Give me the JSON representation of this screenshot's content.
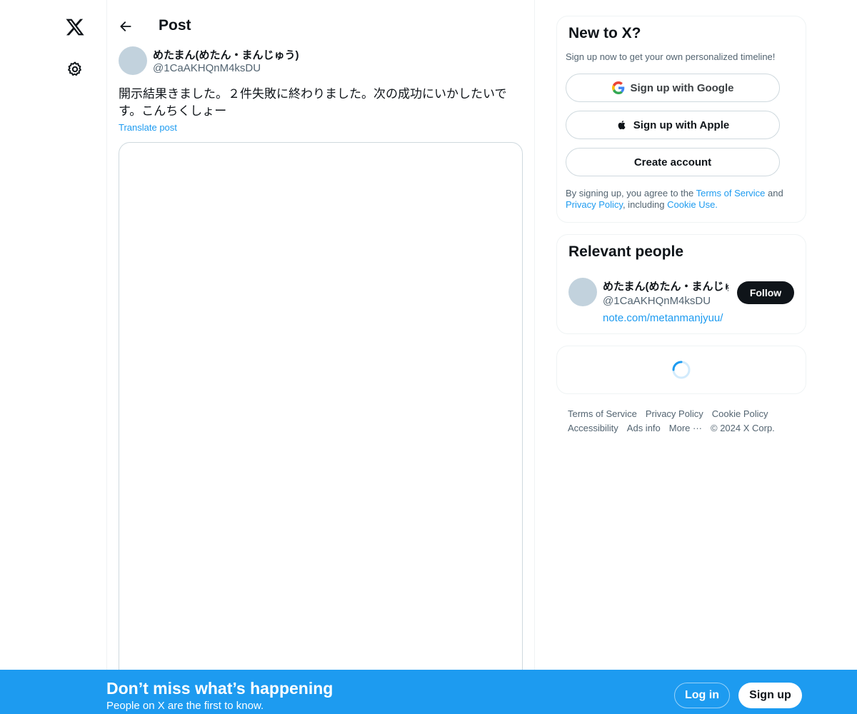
{
  "nav": {
    "logo_icon": "x-logo-icon",
    "settings_icon": "gear-icon"
  },
  "header": {
    "back_icon": "arrow-left-icon",
    "title": "Post"
  },
  "post": {
    "author_name": "めたまん(めたん・まんじゅう)",
    "author_handle": "@1CaAKHQnM4ksDU",
    "text": "開示結果きました。２件失敗に終わりました。次の成功にいかしたいです。こんちくしょー",
    "translate_label": "Translate post"
  },
  "new_to_x": {
    "title": "New to X?",
    "subtitle": "Sign up now to get your own personalized timeline!",
    "google_label": "Sign up with Google",
    "apple_label": "Sign up with Apple",
    "create_label": "Create account",
    "legal_prefix": "By signing up, you agree to the ",
    "terms_link": "Terms of Service",
    "legal_and": " and ",
    "privacy_link": "Privacy Policy",
    "legal_including": ", including ",
    "cookie_link": "Cookie Use."
  },
  "relevant_people": {
    "title": "Relevant people",
    "name": "めたまん(めたん・まんじゅう)",
    "handle": "@1CaAKHQnM4ksDU",
    "bio": "note.com/metanmanjyuu/",
    "follow_label": "Follow"
  },
  "footer": {
    "terms": "Terms of Service",
    "privacy": "Privacy Policy",
    "cookie": "Cookie Policy",
    "accessibility": "Accessibility",
    "ads": "Ads info",
    "more": "More ···",
    "copyright": "© 2024 X Corp."
  },
  "bottom_bar": {
    "title": "Don’t miss what’s happening",
    "subtitle": "People on X are the first to know.",
    "login_label": "Log in",
    "signup_label": "Sign up"
  },
  "colors": {
    "accent": "#1d9bf0",
    "text_primary": "#0f1419",
    "text_secondary": "#536471",
    "border": "#eff3f4",
    "avatar_placeholder": "#c2d2dd"
  }
}
